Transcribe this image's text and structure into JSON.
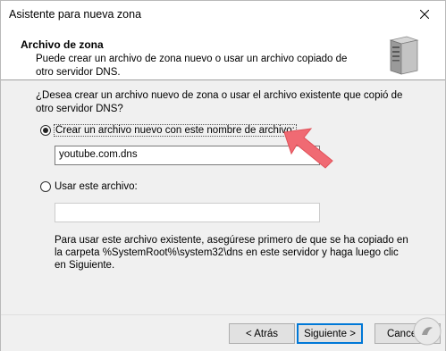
{
  "window": {
    "title": "Asistente para nueva zona"
  },
  "header": {
    "title": "Archivo de zona",
    "subtitle": "Puede crear un archivo de zona nuevo o usar un archivo copiado de otro servidor DNS."
  },
  "body": {
    "question": "¿Desea crear un archivo nuevo de zona o usar el archivo existente que copió de otro servidor DNS?",
    "option_new": {
      "label": "Crear un archivo nuevo con este nombre de archivo:",
      "selected": true
    },
    "filename_value": "youtube.com.dns",
    "option_existing": {
      "label": "Usar este archivo:",
      "selected": false
    },
    "existing_file_value": "",
    "note": "Para usar este archivo existente, asegúrese primero de que se ha copiado en la carpeta %SystemRoot%\\system32\\dns en este servidor y haga luego clic en Siguiente."
  },
  "footer": {
    "back_label": "< Atrás",
    "next_label": "Siguiente >",
    "cancel_label": "Cancelar"
  },
  "colors": {
    "accent": "#0078d7",
    "arrow": "#f06a73"
  },
  "icons": [
    "close-icon",
    "server-icon",
    "pointer-arrow-icon",
    "site-logo-icon"
  ]
}
